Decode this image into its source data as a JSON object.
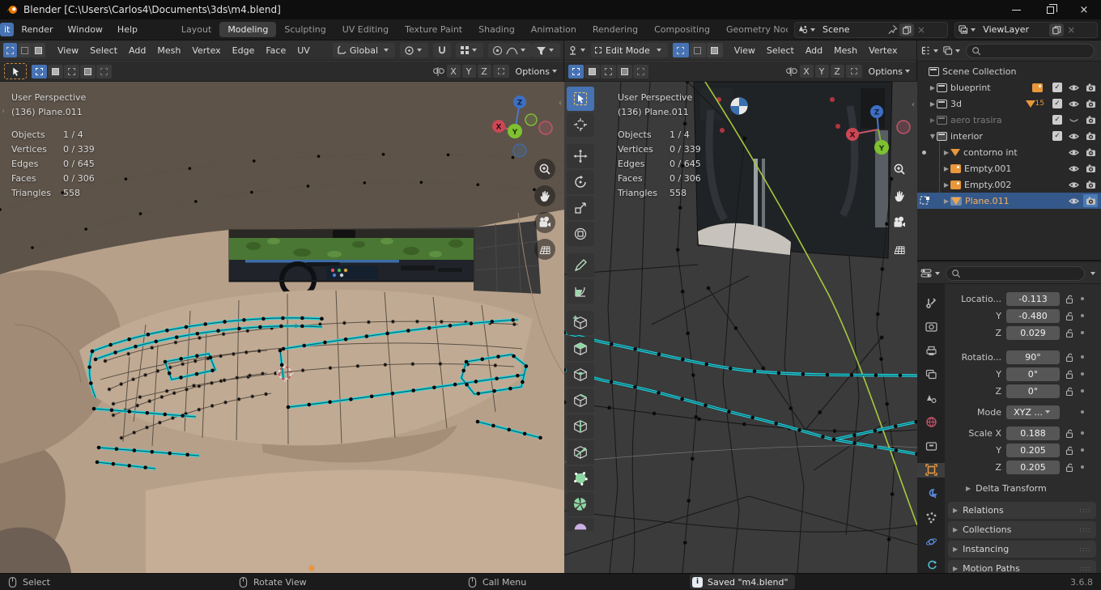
{
  "titlebar": {
    "title": "Blender [C:\\Users\\Carlos4\\Documents\\3ds\\m4.blend]"
  },
  "topbar": {
    "edit_partial": "it",
    "menus": [
      "Render",
      "Window",
      "Help"
    ],
    "workspaces": [
      "Layout",
      "Modeling",
      "Sculpting",
      "UV Editing",
      "Texture Paint",
      "Shading",
      "Animation",
      "Rendering",
      "Compositing",
      "Geometry Noc"
    ],
    "active_workspace": "Modeling",
    "scene": "Scene",
    "viewlayer": "ViewLayer"
  },
  "vp_left": {
    "menus": [
      "View",
      "Select",
      "Add",
      "Mesh",
      "Vertex",
      "Edge",
      "Face",
      "UV"
    ],
    "orientation": "Global",
    "axes": [
      "X",
      "Y",
      "Z"
    ],
    "options": "Options"
  },
  "vp_right": {
    "mode": "Edit Mode",
    "menus": [
      "View",
      "Select",
      "Add",
      "Mesh",
      "Vertex"
    ],
    "axes": [
      "X",
      "Y",
      "Z"
    ],
    "options": "Options"
  },
  "stats": {
    "perspective": "User Perspective",
    "object": "(136) Plane.011",
    "rows": [
      {
        "label": "Objects",
        "value": "1 / 4"
      },
      {
        "label": "Vertices",
        "value": "0 / 339"
      },
      {
        "label": "Edges",
        "value": "0 / 645"
      },
      {
        "label": "Faces",
        "value": "0 / 306"
      },
      {
        "label": "Triangles",
        "value": "558"
      }
    ]
  },
  "outliner": {
    "root": "Scene Collection",
    "rows": [
      {
        "label": "blueprint"
      },
      {
        "label": "3d",
        "badge": "15"
      },
      {
        "label": "aero trasira"
      },
      {
        "label": "interior"
      },
      {
        "label": "contorno int"
      },
      {
        "label": "Empty.001"
      },
      {
        "label": "Empty.002"
      },
      {
        "label": "Plane.011"
      }
    ]
  },
  "properties": {
    "location_label": "Locatio...",
    "location": [
      "-0.113",
      "-0.480",
      "0.029"
    ],
    "rotation_label": "Rotatio...",
    "rotation": [
      "90°",
      "0°",
      "0°"
    ],
    "mode_label": "Mode",
    "mode_value": "XYZ ...",
    "scale_label": "Scale X",
    "scale": [
      "0.188",
      "0.205",
      "0.205"
    ],
    "y_label": "Y",
    "z_label": "Z",
    "delta": "Delta Transform",
    "panels": [
      "Relations",
      "Collections",
      "Instancing",
      "Motion Paths"
    ]
  },
  "statusbar": {
    "hints": [
      "Select",
      "Rotate View",
      "Call Menu"
    ],
    "saved": "Saved \"m4.blend\"",
    "version": "3.6.8"
  },
  "colors": {
    "accent_blue": "#4772b3",
    "selection_cyan": "#1fd3dd",
    "object_orange": "#e8973c"
  }
}
